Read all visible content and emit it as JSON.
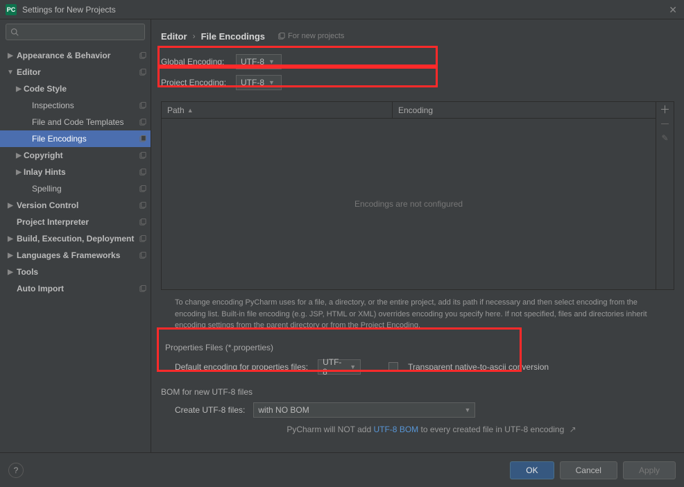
{
  "window": {
    "title": "Settings for New Projects"
  },
  "search": {
    "placeholder": ""
  },
  "sidebar": {
    "items": [
      {
        "label": "Appearance & Behavior",
        "level": 0,
        "chevron": "right",
        "copy": true
      },
      {
        "label": "Editor",
        "level": 0,
        "chevron": "down",
        "copy": true
      },
      {
        "label": "Code Style",
        "level": 1,
        "chevron": "right"
      },
      {
        "label": "Inspections",
        "level": 2,
        "copy": true
      },
      {
        "label": "File and Code Templates",
        "level": 2,
        "copy": true
      },
      {
        "label": "File Encodings",
        "level": 2,
        "copy": true,
        "selected": true
      },
      {
        "label": "Copyright",
        "level": 1,
        "chevron": "right",
        "copy": true
      },
      {
        "label": "Inlay Hints",
        "level": 1,
        "chevron": "right",
        "copy": true
      },
      {
        "label": "Spelling",
        "level": 2,
        "copy": true
      },
      {
        "label": "Version Control",
        "level": 0,
        "chevron": "right",
        "copy": true
      },
      {
        "label": "Project Interpreter",
        "level": 0,
        "copy": true,
        "strong": true
      },
      {
        "label": "Build, Execution, Deployment",
        "level": 0,
        "chevron": "right",
        "copy": true
      },
      {
        "label": "Languages & Frameworks",
        "level": 0,
        "chevron": "right",
        "copy": true
      },
      {
        "label": "Tools",
        "level": 0,
        "chevron": "right"
      },
      {
        "label": "Auto Import",
        "level": 0,
        "copy": true,
        "strong": true
      }
    ]
  },
  "breadcrumb": {
    "a": "Editor",
    "b": "File Encodings",
    "tag": "For new projects"
  },
  "enc": {
    "global_label": "Global Encoding:",
    "global_value": "UTF-8",
    "project_label": "Project Encoding:",
    "project_value": "UTF-8"
  },
  "table": {
    "col_path": "Path",
    "col_enc": "Encoding",
    "empty": "Encodings are not configured"
  },
  "help": "To change encoding PyCharm uses for a file, a directory, or the entire project, add its path if necessary and then select encoding from the encoding list. Built-in file encoding (e.g. JSP, HTML or XML) overrides encoding you specify here. If not specified, files and directories inherit encoding settings from the parent directory or from the Project Encoding.",
  "props": {
    "section": "Properties Files (*.properties)",
    "label": "Default encoding for properties files:",
    "value": "UTF-8",
    "checkbox_label": "Transparent native-to-ascii conversion"
  },
  "bom": {
    "section": "BOM for new UTF-8 files",
    "label": "Create UTF-8 files:",
    "value": "with NO BOM",
    "hint_pre": "PyCharm will NOT add ",
    "hint_link": "UTF-8 BOM",
    "hint_post": " to every created file in UTF-8 encoding"
  },
  "footer": {
    "ok": "OK",
    "cancel": "Cancel",
    "apply": "Apply"
  }
}
